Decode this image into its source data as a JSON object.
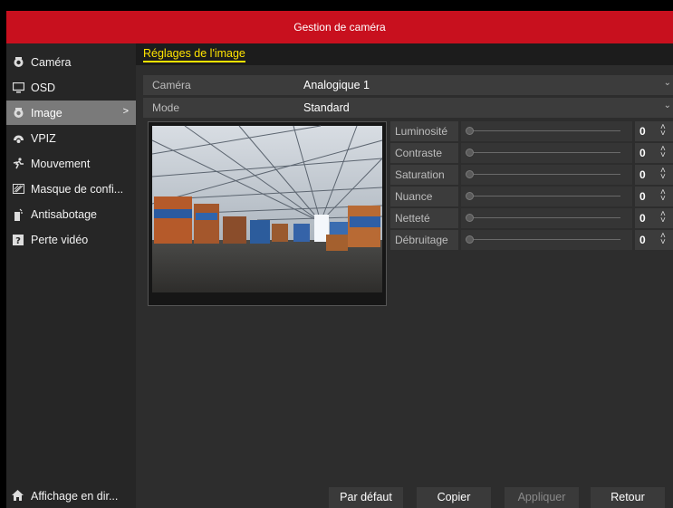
{
  "window": {
    "title": "Gestion de caméra"
  },
  "sidebar": {
    "items": [
      {
        "label": "Caméra",
        "icon": "camera-icon",
        "active": false
      },
      {
        "label": "OSD",
        "icon": "monitor-icon",
        "active": false
      },
      {
        "label": "Image",
        "icon": "image-icon",
        "active": true
      },
      {
        "label": "VPIZ",
        "icon": "ptz-icon",
        "active": false
      },
      {
        "label": "Mouvement",
        "icon": "motion-icon",
        "active": false
      },
      {
        "label": "Masque de confi...",
        "icon": "privacy-mask-icon",
        "active": false
      },
      {
        "label": "Antisabotage",
        "icon": "tamper-icon",
        "active": false
      },
      {
        "label": "Perte vidéo",
        "icon": "video-loss-icon",
        "active": false
      }
    ],
    "active_arrow": ">",
    "footer": {
      "label": "Affichage en dir...",
      "icon": "home-icon"
    }
  },
  "main": {
    "tab": "Réglages de l'image",
    "camera": {
      "label": "Caméra",
      "value": "Analogique 1"
    },
    "mode": {
      "label": "Mode",
      "value": "Standard"
    },
    "adjustments": [
      {
        "label": "Luminosité",
        "value": "0"
      },
      {
        "label": "Contraste",
        "value": "0"
      },
      {
        "label": "Saturation",
        "value": "0"
      },
      {
        "label": "Nuance",
        "value": "0"
      },
      {
        "label": "Netteté",
        "value": "0"
      },
      {
        "label": "Débruitage",
        "value": "0"
      }
    ]
  },
  "buttons": {
    "default": "Par défaut",
    "copy": "Copier",
    "apply": "Appliquer",
    "back": "Retour"
  },
  "colors": {
    "titlebar": "#c8101e",
    "tab_accent": "#ffe400"
  }
}
